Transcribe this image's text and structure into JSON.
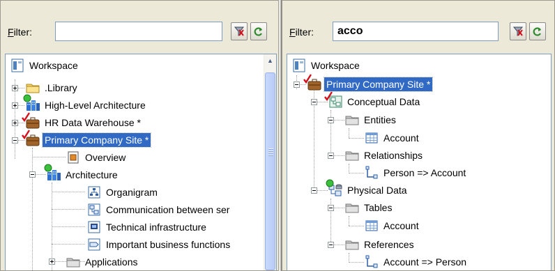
{
  "left": {
    "filter": {
      "label_prefix": "F",
      "label_rest": "ilter:",
      "value": ""
    },
    "tree": {
      "workspace": "Workspace",
      "library": ".Library",
      "high_level": "High-Level Architecture",
      "hr_dw": "HR Data Warehouse *",
      "primary_site": "Primary Company Site *",
      "overview": "Overview",
      "architecture": "Architecture",
      "organigram": "Organigram",
      "communication": "Communication between ser",
      "technical": "Technical infrastructure",
      "business_functions": "Important business functions",
      "applications": "Applications"
    }
  },
  "right": {
    "filter": {
      "label_prefix": "F",
      "label_rest": "ilter:",
      "value": "acco"
    },
    "tree": {
      "workspace": "Workspace",
      "primary_site": "Primary Company Site *",
      "conceptual": "Conceptual Data",
      "entities": "Entities",
      "account_entity": "Account",
      "relationships": "Relationships",
      "person_account": "Person => Account",
      "physical": "Physical Data",
      "tables": "Tables",
      "account_table": "Account",
      "references": "References",
      "account_person": "Account => Person"
    }
  },
  "colors": {
    "selection": "#316ac5",
    "panel": "#ece9d8",
    "tree_border": "#7f9db9"
  }
}
